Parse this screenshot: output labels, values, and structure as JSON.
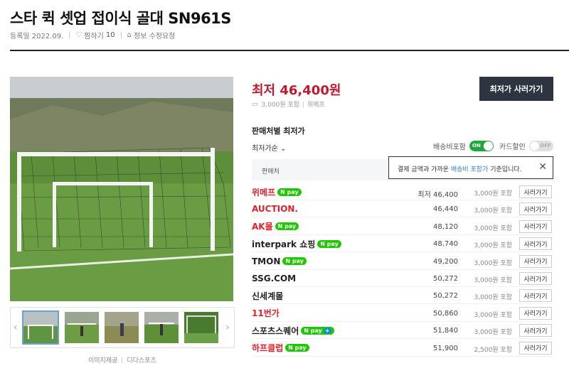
{
  "header": {
    "title": "스타 퀵 셋업 접이식 골대 SN961S",
    "reg_date": "등록일 2022.09.",
    "zzim_label": "찜하기",
    "zzim_count": "10",
    "report_label": "정보 수정요청"
  },
  "gallery": {
    "image_credit": "이미지제공",
    "credit_source": "디다스포츠",
    "prev_icon": "chevron-left-icon",
    "next_icon": "chevron-right-icon"
  },
  "price": {
    "lowest_label": "최저 46,400원",
    "buy_button": "최저가 사러가기",
    "shipping_info": "3,000원 포함",
    "shop_info": "위메프"
  },
  "seller_section": {
    "title": "판매처별 최저가",
    "sort_label": "최저가순",
    "toggle_shipping_label": "배송비포함",
    "toggle_shipping_state": "ON",
    "toggle_card_label": "카드할인",
    "toggle_card_state": "OFF",
    "table_header": "판매처",
    "tooltip_pre": "결제 금액과 가까운 ",
    "tooltip_hl": "배송비 포함가",
    "tooltip_post": " 기준입니다.",
    "rows": [
      {
        "mall": "위메프",
        "color": "#e4202a",
        "npay": "pay",
        "price": "최저 46,400",
        "ship": "3,000원 포함",
        "btn": "사러가기"
      },
      {
        "mall": "AUCTION.",
        "color": "#e4202a",
        "npay": "",
        "price": "46,440",
        "ship": "3,000원 포함",
        "btn": "사러가기"
      },
      {
        "mall": "AK몰",
        "color": "#e4202a",
        "npay": "pay",
        "price": "48,120",
        "ship": "3,000원 포함",
        "btn": "사러가기"
      },
      {
        "mall": "interpark 쇼핑",
        "color": "#222222",
        "npay": "pay",
        "price": "48,740",
        "ship": "3,000원 포함",
        "btn": "사러가기"
      },
      {
        "mall": "TMON",
        "color": "#222222",
        "npay": "pay",
        "price": "49,200",
        "ship": "3,000원 포함",
        "btn": "사러가기"
      },
      {
        "mall": "SSG.COM",
        "color": "#222222",
        "npay": "",
        "price": "50,272",
        "ship": "3,000원 포함",
        "btn": "사러가기"
      },
      {
        "mall": "신세계몰",
        "color": "#222222",
        "npay": "",
        "price": "50,272",
        "ship": "3,000원 포함",
        "btn": "사러가기"
      },
      {
        "mall": "11번가",
        "color": "#e4202a",
        "npay": "",
        "price": "50,860",
        "ship": "3,000원 포함",
        "btn": "사러가기"
      },
      {
        "mall": "스포츠스퀘어",
        "color": "#222222",
        "npay": "pay+",
        "price": "51,840",
        "ship": "3,000원 포함",
        "btn": "사러가기"
      },
      {
        "mall": "하프클럽",
        "color": "#e4202a",
        "npay": "pay",
        "price": "51,900",
        "ship": "2,500원 포함",
        "btn": "사러가기"
      }
    ]
  }
}
